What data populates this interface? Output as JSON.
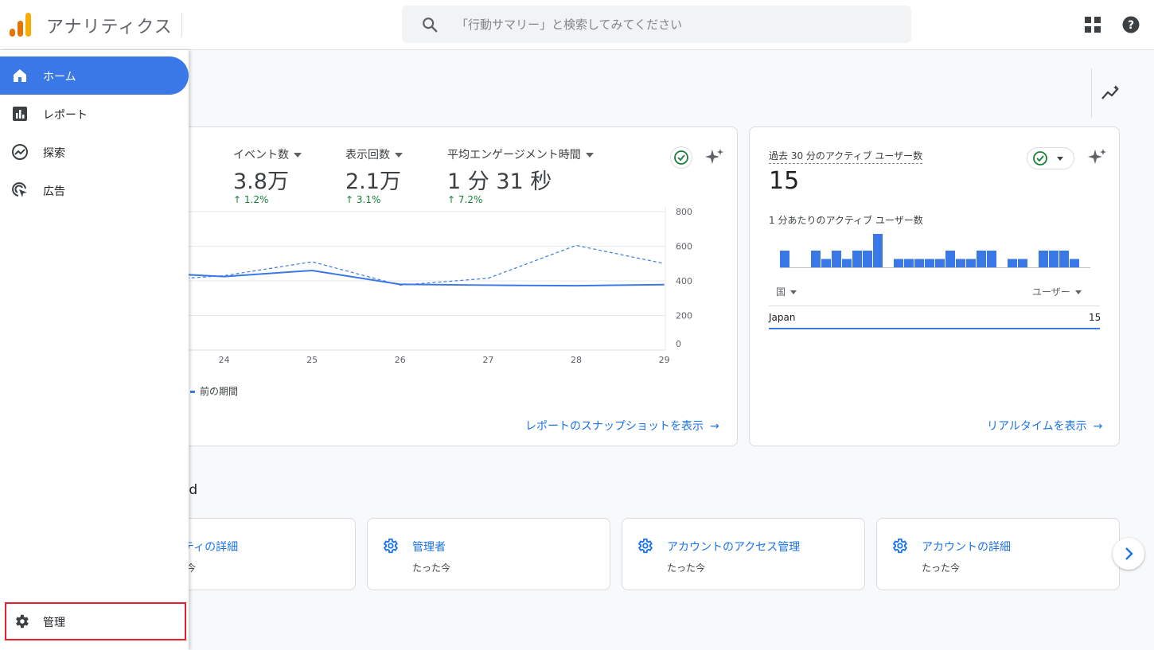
{
  "app": {
    "title": "アナリティクス"
  },
  "search": {
    "placeholder": "「行動サマリー」と検索してみてください"
  },
  "sidebar": {
    "items": [
      {
        "label": "ホーム",
        "icon": "home-icon",
        "active": true
      },
      {
        "label": "レポート",
        "icon": "bar-chart-icon",
        "active": false
      },
      {
        "label": "探索",
        "icon": "explore-icon",
        "active": false
      },
      {
        "label": "広告",
        "icon": "ads-icon",
        "active": false
      }
    ],
    "admin": {
      "label": "管理",
      "icon": "gear-icon"
    }
  },
  "overview": {
    "metrics": [
      {
        "label": "イベント数",
        "value": "3.8万",
        "change": "1.2%"
      },
      {
        "label": "表示回数",
        "value": "2.1万",
        "change": "3.1%"
      },
      {
        "label": "平均エンゲージメント時間",
        "value": "1 分 31 秒",
        "change": "7.2%"
      }
    ],
    "legend_current": "間",
    "legend_previous": "前の期間",
    "period_label": "間",
    "link": "レポートのスナップショットを表示",
    "arrow": "→"
  },
  "chart_data": {
    "type": "line",
    "x": [
      "23",
      "24",
      "25",
      "26",
      "27",
      "28",
      "29"
    ],
    "x_tick_labels": [
      "24",
      "25",
      "26",
      "27",
      "28",
      "29"
    ],
    "y_tick_labels": [
      "800",
      "600",
      "400",
      "200",
      "0"
    ],
    "ylim": [
      0,
      800
    ],
    "series": [
      {
        "name": "間",
        "style": "solid",
        "color": "#3b78e7",
        "values": [
          450,
          425,
          460,
          380,
          375,
          372,
          378
        ]
      },
      {
        "name": "前の期間",
        "style": "dashed",
        "color": "#3b78e7",
        "values": [
          395,
          430,
          510,
          375,
          415,
          605,
          500
        ]
      }
    ],
    "grid": true,
    "legend": "bottom-left"
  },
  "realtime": {
    "label": "過去 30 分のアクティブ ユーザー数",
    "value": "15",
    "sub_label": "1 分あたりのアクティブ ユーザー数",
    "bar_color": "#3b78e7",
    "bars": [
      2,
      0,
      0,
      2,
      1,
      2,
      1,
      2,
      2,
      4,
      0,
      1,
      1,
      1,
      1,
      1,
      2,
      1,
      1,
      2,
      2,
      0,
      1,
      1,
      0,
      2,
      2,
      2,
      1
    ],
    "bar_max": 4,
    "col_left": "国",
    "col_right": "ユーザー",
    "rows": [
      {
        "country": "Japan",
        "users": "15"
      }
    ],
    "link": "リアルタイムを表示",
    "arrow": "→"
  },
  "recent": {
    "title": "ccessed",
    "items": [
      {
        "title": "ティの詳細",
        "time": "今"
      },
      {
        "title": "管理者",
        "time": "たった今"
      },
      {
        "title": "アカウントのアクセス管理",
        "time": "たった今"
      },
      {
        "title": "アカウントの詳細",
        "time": "たった今"
      }
    ]
  }
}
